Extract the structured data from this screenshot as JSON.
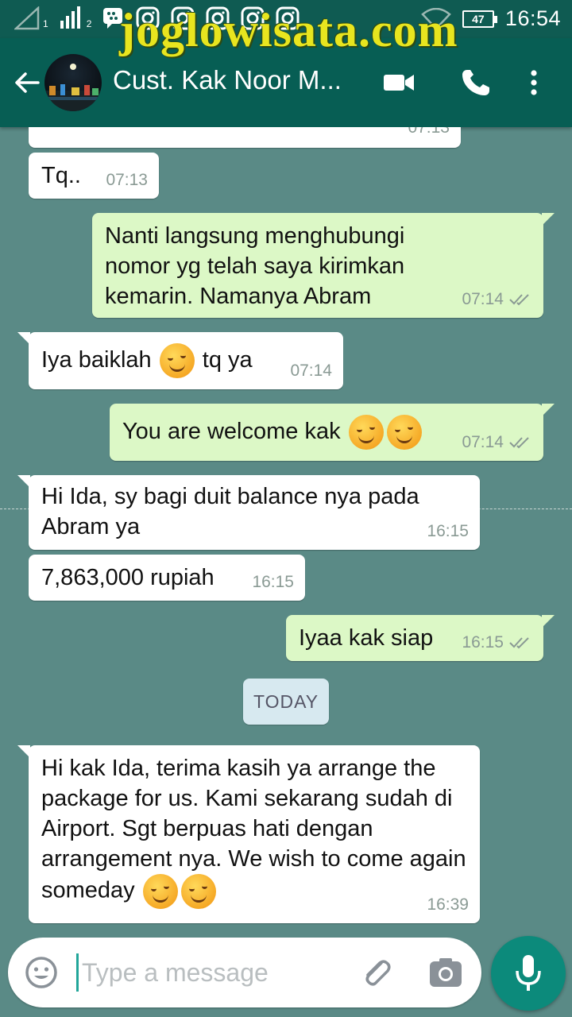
{
  "statusbar": {
    "sim1": "1",
    "sim2": "2",
    "battery": "47",
    "time": "16:54",
    "icons": [
      "signal-icon",
      "blackberry-messenger-icon",
      "instagram-icon",
      "instagram-icon",
      "instagram-icon",
      "instagram-icon",
      "instagram-icon",
      "wifi-icon",
      "battery-icon"
    ]
  },
  "watermark": "joglowisata.com",
  "header": {
    "contact_name": "Cust. Kak Noor M...",
    "icons": [
      "back-arrow-icon",
      "video-call-icon",
      "phone-icon",
      "more-vert-icon"
    ]
  },
  "messages": [
    {
      "dir": "in",
      "text": "",
      "time": "07:13"
    },
    {
      "dir": "in",
      "text": "Tq..",
      "time": "07:13"
    },
    {
      "dir": "out",
      "text": "Nanti langsung menghubungi nomor yg telah saya kirimkan kemarin. Namanya Abram",
      "time": "07:14",
      "status": "read"
    },
    {
      "dir": "in",
      "text_before": "Iya baiklah",
      "text_after": "tq ya",
      "time": "07:14"
    },
    {
      "dir": "out",
      "text": "You are welcome kak",
      "time": "07:14",
      "status": "read"
    },
    {
      "dir": "in",
      "text": "Hi Ida, sy bagi duit balance nya pada Abram ya",
      "time": "16:15"
    },
    {
      "dir": "in",
      "text": "7,863,000 rupiah",
      "time": "16:15"
    },
    {
      "dir": "out",
      "text": "Iyaa kak siap",
      "time": "16:15",
      "status": "read"
    },
    {
      "dir": "in",
      "text": "Hi kak Ida, terima kasih ya arrange the package for us. Kami sekarang sudah di Airport. Sgt berpuas hati dengan arrangement nya. We wish to come again someday",
      "time": "16:39"
    }
  ],
  "date_separator": "TODAY",
  "composer": {
    "placeholder": "Type a message",
    "icons": [
      "emoji-icon",
      "attach-icon",
      "camera-icon",
      "mic-icon"
    ]
  },
  "colors": {
    "header": "#075e54",
    "statusbar": "#0f5b52",
    "chat_bg": "#5a8a86",
    "incoming": "#ffffff",
    "outgoing": "#dcf8c6",
    "accent": "#0c8a7b"
  }
}
